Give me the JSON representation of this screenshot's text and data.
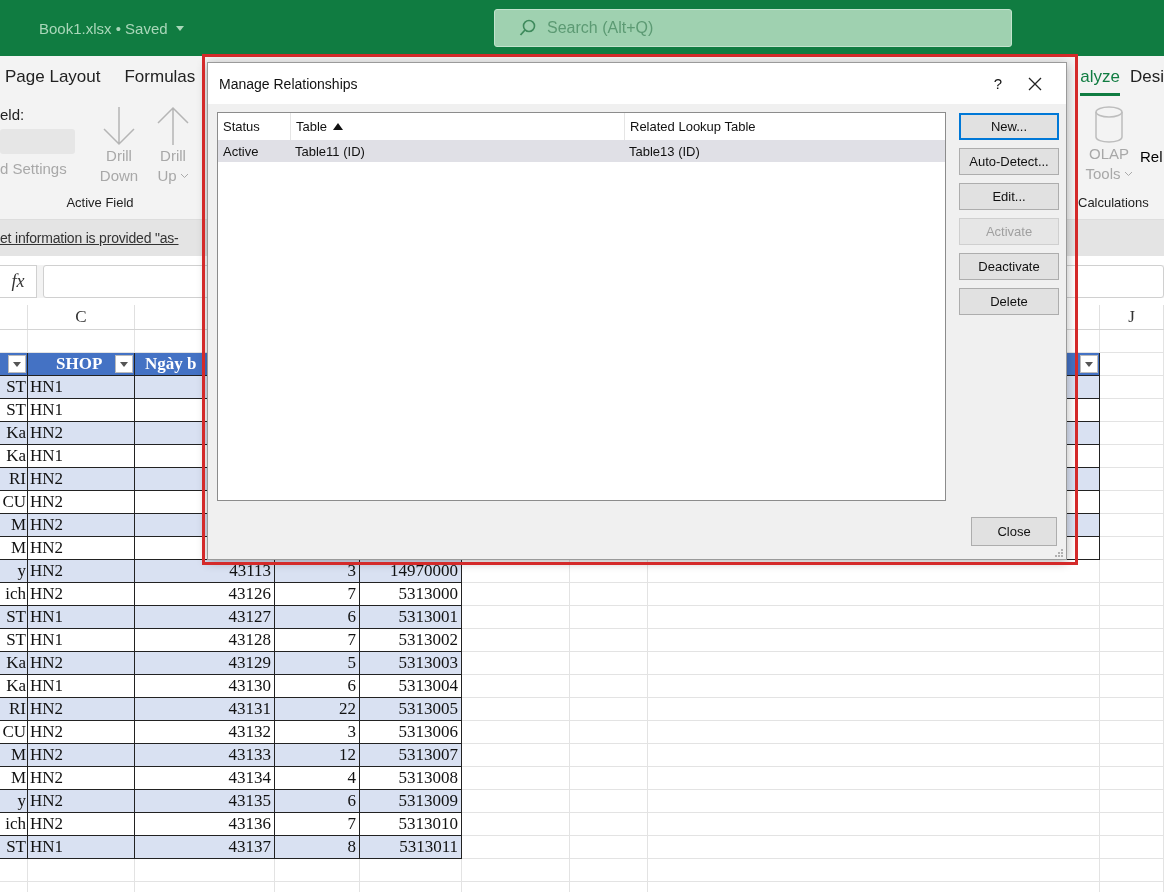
{
  "title_bar": {
    "file_name": "Book1.xlsx • Saved",
    "search": {
      "placeholder": "Search (Alt+Q)"
    }
  },
  "ribbon_tabs": [
    {
      "label": "Page Layout",
      "selected": false
    },
    {
      "label": "Formulas",
      "selected": false
    },
    {
      "label": "alyze",
      "selected": true
    },
    {
      "label": "Desi",
      "selected": false
    }
  ],
  "active_field_group": {
    "field_label": "eld:",
    "settings_label": "d Settings",
    "group_label": "Active Field",
    "buttons": [
      {
        "kind": "down",
        "lines": [
          "Drill",
          "Down"
        ],
        "disabled": true,
        "dropdown": false
      },
      {
        "kind": "up",
        "lines": [
          "Drill",
          "Up"
        ],
        "disabled": true,
        "dropdown": true
      }
    ]
  },
  "calculations_group": {
    "olap": {
      "lines": [
        "OLAP",
        "Tools"
      ],
      "disabled": true,
      "dropdown": true
    },
    "next_label": "Rel",
    "group_label": "Calculations"
  },
  "message_bar": {
    "text": "et information is provided \"as-"
  },
  "formula_bar": {
    "function_symbol": "fx"
  },
  "column_headers": [
    "C",
    "J"
  ],
  "sheet_table": {
    "header": {
      "first_filter": true,
      "shop": "SHOP",
      "date": "Ngày b",
      "last_filter": true
    },
    "rows": [
      {
        "b": "ST",
        "c": "HN1"
      },
      {
        "b": "ST",
        "c": "HN1"
      },
      {
        "b": "Ka",
        "c": "HN2"
      },
      {
        "b": "Ka",
        "c": "HN1"
      },
      {
        "b": "RI",
        "c": "HN2"
      },
      {
        "b": "CU",
        "c": "HN2"
      },
      {
        "b": "M",
        "c": "HN2"
      },
      {
        "b": "M",
        "c": "HN2"
      },
      {
        "b": "y",
        "c": "HN2",
        "d": "43113",
        "e": "3",
        "f": "14970000"
      },
      {
        "b": "ich",
        "c": "HN2",
        "d": "43126",
        "e": "7",
        "f": "5313000"
      },
      {
        "b": "ST",
        "c": "HN1",
        "d": "43127",
        "e": "6",
        "f": "5313001"
      },
      {
        "b": "ST",
        "c": "HN1",
        "d": "43128",
        "e": "7",
        "f": "5313002"
      },
      {
        "b": "Ka",
        "c": "HN2",
        "d": "43129",
        "e": "5",
        "f": "5313003"
      },
      {
        "b": "Ka",
        "c": "HN1",
        "d": "43130",
        "e": "6",
        "f": "5313004"
      },
      {
        "b": "RI",
        "c": "HN2",
        "d": "43131",
        "e": "22",
        "f": "5313005"
      },
      {
        "b": "CU",
        "c": "HN2",
        "d": "43132",
        "e": "3",
        "f": "5313006"
      },
      {
        "b": "M",
        "c": "HN2",
        "d": "43133",
        "e": "12",
        "f": "5313007"
      },
      {
        "b": "M",
        "c": "HN2",
        "d": "43134",
        "e": "4",
        "f": "5313008"
      },
      {
        "b": "y",
        "c": "HN2",
        "d": "43135",
        "e": "6",
        "f": "5313009"
      },
      {
        "b": "ich",
        "c": "HN2",
        "d": "43136",
        "e": "7",
        "f": "5313010"
      },
      {
        "b": "ST",
        "c": "HN1",
        "d": "43137",
        "e": "8",
        "f": "5313011"
      }
    ]
  },
  "dialog": {
    "title": "Manage Relationships",
    "help": "?",
    "columns": [
      {
        "label": "Status",
        "sort_ascending": false
      },
      {
        "label": "Table",
        "sort_ascending": true
      },
      {
        "label": "Related Lookup Table",
        "sort_ascending": false
      }
    ],
    "relationships": [
      {
        "status": "Active",
        "table": "Table11 (ID)",
        "related": "Table13 (ID)",
        "selected": true
      }
    ],
    "buttons": [
      {
        "label": "New...",
        "disabled": false,
        "default": true
      },
      {
        "label": "Auto-Detect...",
        "disabled": false,
        "default": false
      },
      {
        "label": "Edit...",
        "disabled": false,
        "default": false
      },
      {
        "label": "Activate",
        "disabled": true,
        "default": false
      },
      {
        "label": "Deactivate",
        "disabled": false,
        "default": false
      },
      {
        "label": "Delete",
        "disabled": false,
        "default": false
      }
    ],
    "close_button": "Close"
  }
}
